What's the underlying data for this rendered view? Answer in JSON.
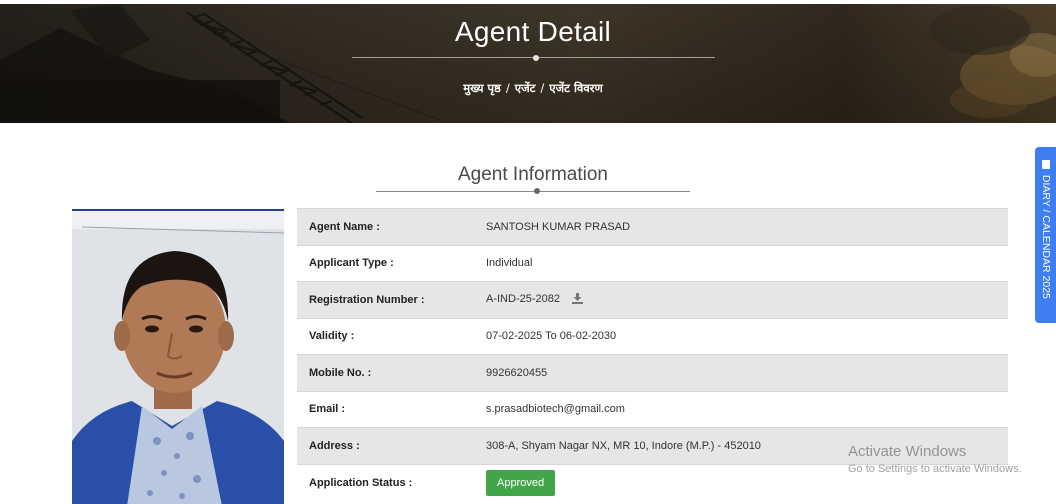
{
  "banner": {
    "title": "Agent Detail",
    "breadcrumb": {
      "home": "मुख्य पृष्ठ",
      "separator": "/",
      "agents": "एजेंट",
      "current": "एजेंट विवरण"
    }
  },
  "section": {
    "title": "Agent Information"
  },
  "agent": {
    "rows": [
      {
        "label": "Agent Name :",
        "value": "SANTOSH KUMAR PRASAD"
      },
      {
        "label": "Applicant Type :",
        "value": "Individual"
      },
      {
        "label": "Registration Number :",
        "value": "A-IND-25-2082"
      },
      {
        "label": "Validity :",
        "value": "07-02-2025 To 06-02-2030"
      },
      {
        "label": "Mobile No. :",
        "value": "9926620455"
      },
      {
        "label": "Email :",
        "value": "s.prasadbiotech@gmail.com"
      },
      {
        "label": "Address :",
        "value": "308-A, Shyam Nagar NX, MR 10, Indore (M.P.) - 452010"
      },
      {
        "label": "Application Status :",
        "value": "Approved"
      }
    ],
    "download_icon": "download-icon",
    "status_color": "#43a54a"
  },
  "diary_tab": {
    "label": "DIARY / CALENDAR 2025",
    "icon": "book-icon",
    "color": "#3f7ef0"
  },
  "windows_watermark": {
    "title": "Activate Windows",
    "subtitle": "Go to Settings to activate Windows."
  }
}
